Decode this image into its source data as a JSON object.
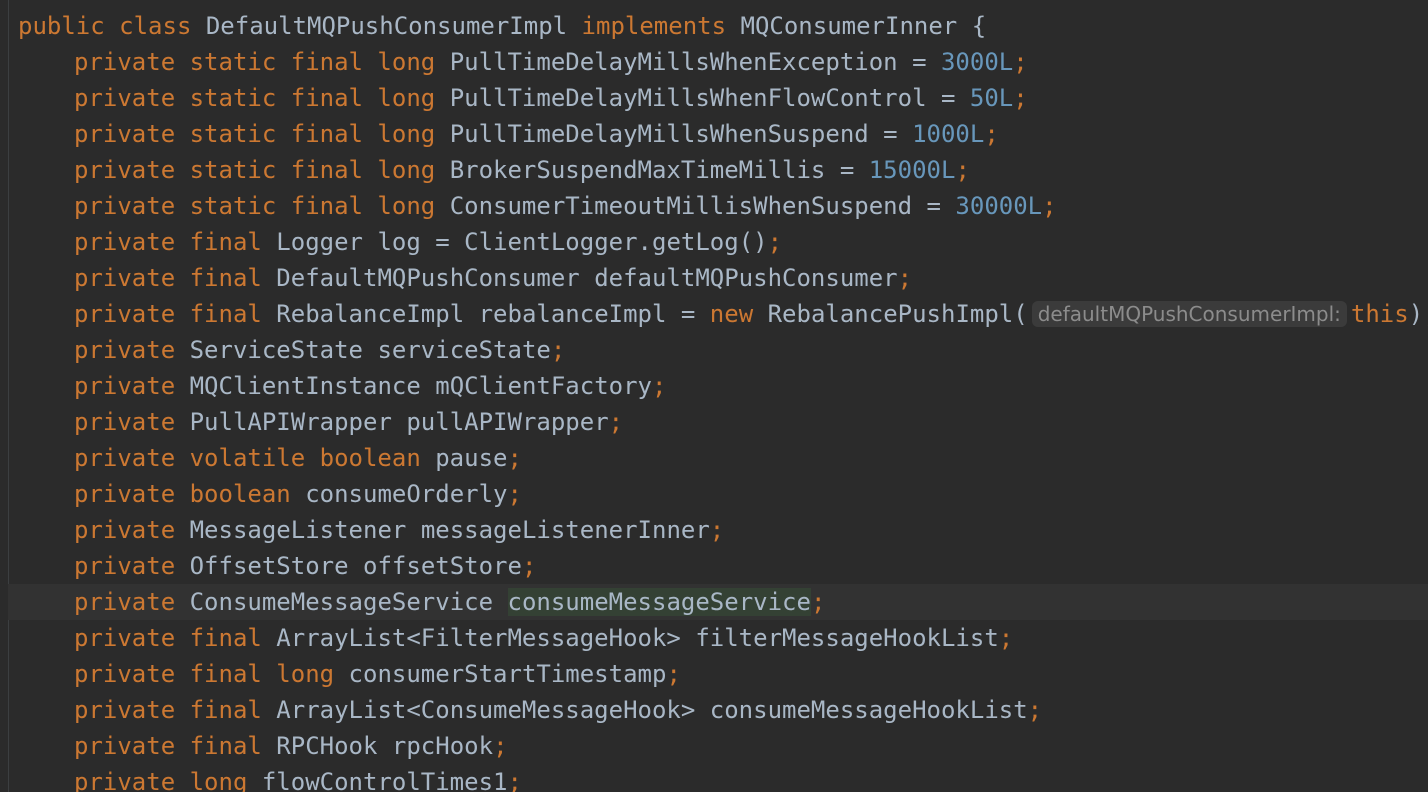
{
  "editor": {
    "language": "java",
    "colors": {
      "background": "#2b2b2b",
      "keyword": "#cc7832",
      "identifier": "#a9b7c6",
      "number": "#6897bb",
      "hint": "#8c8c8c",
      "current_line": "#323232",
      "identifier_highlight": "#344134"
    },
    "lines": [
      {
        "kw1": "public",
        "kw2": "class",
        "name": "DefaultMQPushConsumerImpl",
        "kw3": "implements",
        "iface": "MQConsumerInner",
        "brace": "{"
      },
      {
        "mods": "private static final long",
        "name": "PullTimeDelayMillsWhenException",
        "eq": "=",
        "value": "3000L",
        "end": ";"
      },
      {
        "mods": "private static final long",
        "name": "PullTimeDelayMillsWhenFlowControl",
        "eq": "=",
        "value": "50L",
        "end": ";"
      },
      {
        "mods": "private static final long",
        "name": "PullTimeDelayMillsWhenSuspend",
        "eq": "=",
        "value": "1000L",
        "end": ";"
      },
      {
        "mods": "private static final long",
        "name": "BrokerSuspendMaxTimeMillis",
        "eq": "=",
        "value": "15000L",
        "end": ";"
      },
      {
        "mods": "private static final long",
        "name": "ConsumerTimeoutMillisWhenSuspend",
        "eq": "=",
        "value": "30000L",
        "end": ";"
      },
      {
        "mods": "private final",
        "type": "Logger",
        "name": "log",
        "rest": "= ClientLogger.getLog()",
        "end": ";"
      },
      {
        "mods": "private final",
        "type": "DefaultMQPushConsumer",
        "name": "defaultMQPushConsumer",
        "end": ";"
      },
      {
        "mods": "private final",
        "type": "RebalanceImpl",
        "name": "rebalanceImpl",
        "eq": "=",
        "kw": "new",
        "ctor": "RebalancePushImpl(",
        "hint": "defaultMQPushConsumerImpl:",
        "arg": "this",
        "close": ")",
        "end": ";"
      },
      {
        "mods": "private",
        "type": "ServiceState",
        "name": "serviceState",
        "end": ";"
      },
      {
        "mods": "private",
        "type": "MQClientInstance",
        "name": "mQClientFactory",
        "end": ";"
      },
      {
        "mods": "private",
        "type": "PullAPIWrapper",
        "name": "pullAPIWrapper",
        "end": ";"
      },
      {
        "mods": "private volatile boolean",
        "name": "pause",
        "end": ";"
      },
      {
        "mods": "private boolean",
        "name": "consumeOrderly",
        "end": ";"
      },
      {
        "mods": "private",
        "type": "MessageListener",
        "name": "messageListenerInner",
        "end": ";"
      },
      {
        "mods": "private",
        "type": "OffsetStore",
        "name": "offsetStore",
        "end": ";"
      },
      {
        "mods": "private",
        "type": "ConsumeMessageService",
        "name": "consumeMessageService",
        "end": ";"
      },
      {
        "mods": "private final",
        "type": "ArrayList<FilterMessageHook>",
        "name": "filterMessageHookList",
        "end": ";"
      },
      {
        "mods": "private final long",
        "name": "consumerStartTimestamp",
        "end": ";"
      },
      {
        "mods": "private final",
        "type": "ArrayList<ConsumeMessageHook>",
        "name": "consumeMessageHookList",
        "end": ";"
      },
      {
        "mods": "private final",
        "type": "RPCHook",
        "name": "rpcHook",
        "end": ";"
      },
      {
        "mods": "private long",
        "name": "flowControlTimes1",
        "end": ";"
      }
    ]
  }
}
